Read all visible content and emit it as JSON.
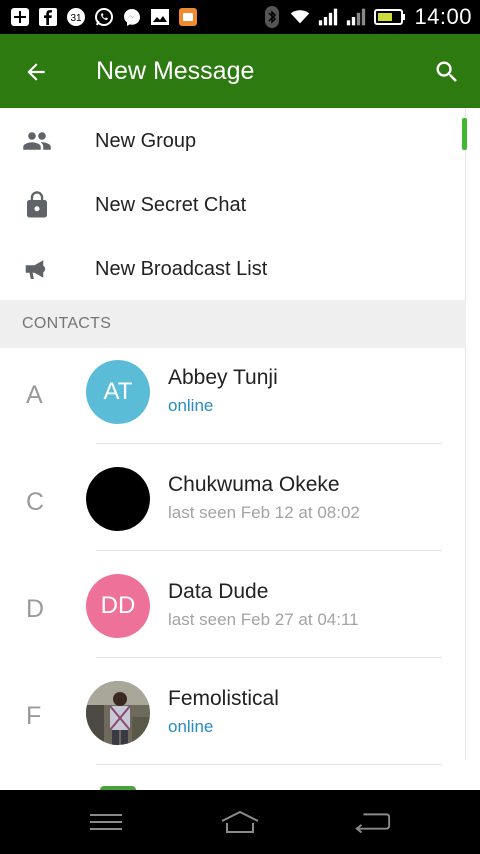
{
  "status_bar": {
    "time": "14:00",
    "icons": [
      "add-box-icon",
      "facebook-icon",
      "calendar-icon",
      "whatsapp-icon",
      "messenger-icon",
      "gallery-icon",
      "app-icon",
      "bluetooth-icon",
      "wifi-icon",
      "signal-icon",
      "signal-icon",
      "battery-icon"
    ],
    "calendar_day": "31"
  },
  "appbar": {
    "title": "New Message",
    "back_icon": "arrow-back-icon",
    "search_icon": "search-icon",
    "color": "#2c7a10"
  },
  "menu": [
    {
      "label": "New Group",
      "icon": "group-icon"
    },
    {
      "label": "New Secret Chat",
      "icon": "lock-icon"
    },
    {
      "label": "New Broadcast List",
      "icon": "megaphone-icon"
    }
  ],
  "section": {
    "title": "CONTACTS"
  },
  "contacts": [
    {
      "letter": "A",
      "initials": "AT",
      "name": "Abbey Tunji",
      "status": "online",
      "avatar_color": "#5bbcd8"
    },
    {
      "letter": "C",
      "initials": "",
      "name": "Chukwuma Okeke",
      "status": "last seen Feb 12 at 08:02",
      "avatar_color": "#000000"
    },
    {
      "letter": "D",
      "initials": "DD",
      "name": "Data Dude",
      "status": "last seen Feb 27 at 04:11",
      "avatar_color": "#ee7199"
    },
    {
      "letter": "F",
      "initials": "",
      "name": "Femolistical",
      "status": "online",
      "avatar_color": "#8a8a7c"
    }
  ],
  "colors": {
    "online": "#2a8bc2",
    "offline": "#a3a3a3",
    "scroll_indicator": "#40b830"
  },
  "navbar": {
    "icons": [
      "menu-icon",
      "home-icon",
      "back-icon"
    ]
  }
}
